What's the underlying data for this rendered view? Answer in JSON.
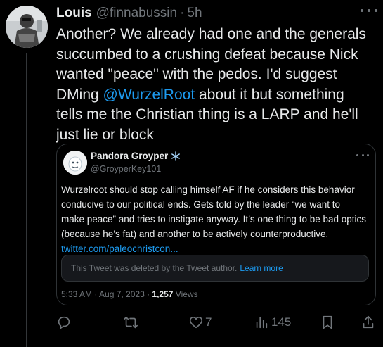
{
  "tweet": {
    "author_name": "Louis",
    "handle": "@finnabussin",
    "separator": "·",
    "time": "5h",
    "text_lines": [
      "Another? We already had one and the generals",
      "succumbed to a crushing defeat because Nick",
      "wanted \"peace\" with the pedos. I'd suggest"
    ],
    "text_line4_prefix": "DMing ",
    "mention": "@WurzelRoot",
    "text_line4_suffix": " about it but something",
    "text_lines_end": [
      "tells me the Christian thing is a LARP and he'll",
      "just lie or block"
    ]
  },
  "quote": {
    "author_name": "Pandora Groyper",
    "handle": "@GroyperKey101",
    "text_lines": [
      "Wurzelroot should stop calling himself AF if he considers this behavior",
      "conducive to our political ends. Gets told by the leader “we want to",
      "make peace” and tries to instigate anyway. It’s one thing to be bad optics",
      "(because he’s fat) and another to be actively counterproductive."
    ],
    "link": "twitter.com/paleochristcon...",
    "deleted_notice": "This Tweet was deleted by the Tweet author.",
    "learn_more": "Learn more",
    "timestamp": "5:33 AM · Aug 7, 2023 · ",
    "views_count": "1,257",
    "views_label": " Views"
  },
  "actions": {
    "reply_count": "",
    "retweet_count": "",
    "like_count": "7",
    "views_count": "145"
  },
  "colors": {
    "background": "#000000",
    "text": "#e7e9ea",
    "muted": "#71767b",
    "accent": "#1d9bf0",
    "border": "#2f3336"
  }
}
